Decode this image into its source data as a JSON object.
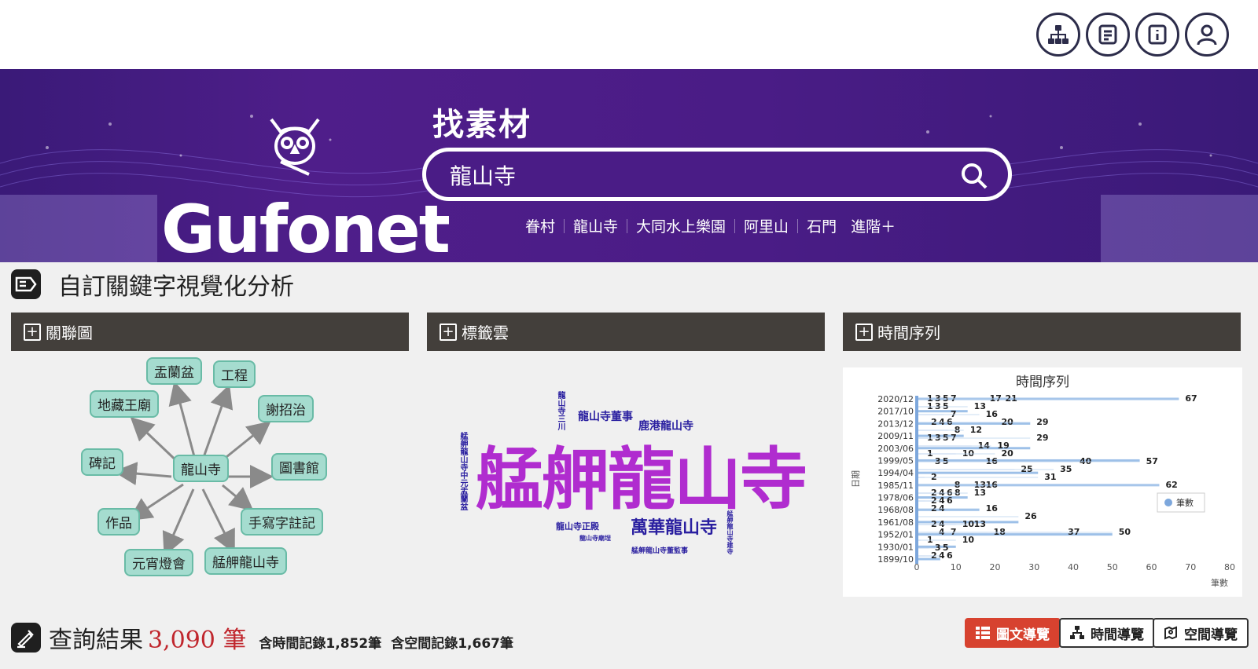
{
  "topbar": {
    "icons": [
      "sitemap-icon",
      "document-list-icon",
      "info-book-icon",
      "user-icon"
    ]
  },
  "banner": {
    "logo_text": "Gufonet",
    "search_title": "找素材",
    "search_value": "龍山寺",
    "quick_links": [
      "眷村",
      "龍山寺",
      "大同水上樂園",
      "阿里山",
      "石門",
      "進階＋"
    ]
  },
  "section": {
    "title": "自訂關鍵字視覺化分析"
  },
  "panels": {
    "network": "關聯圖",
    "tagcloud": "標籤雲",
    "timeseries": "時間序列"
  },
  "network": {
    "center": "龍山寺",
    "nodes": [
      "盂蘭盆",
      "工程",
      "地藏王廟",
      "謝招治",
      "碑記",
      "圖書館",
      "作品",
      "手寫字註記",
      "元宵燈會",
      "艋舺龍山寺"
    ]
  },
  "tagcloud": {
    "words": [
      "艋舺龍山寺",
      "萬華龍山寺",
      "龍山寺董事",
      "鹿港龍山寺",
      "龍山寺三川",
      "艋舺龍山寺中元盂蘭盆",
      "龍山寺正殿",
      "龍山寺廟埕",
      "艋舺龍山寺董監事",
      "艋舺龍山寺建寺"
    ]
  },
  "chart_data": {
    "type": "bar",
    "orientation": "horizontal",
    "title": "時間序列",
    "xlabel": "筆數",
    "ylabel": "日期",
    "xlim": [
      0,
      80
    ],
    "x_ticks": [
      0,
      10,
      20,
      30,
      40,
      50,
      60,
      70,
      80
    ],
    "legend": {
      "entries": [
        "筆數"
      ],
      "placement": "right"
    },
    "categories": [
      "2020/12",
      "2017/10",
      "2013/12",
      "2009/11",
      "2003/06",
      "1999/05",
      "1994/04",
      "1985/11",
      "1978/06",
      "1968/08",
      "1961/08",
      "1952/01",
      "1930/01",
      "1899/10"
    ],
    "series": [
      {
        "name": "筆數",
        "values": [
          67,
          13,
          29,
          12,
          29,
          57,
          31,
          62,
          13,
          16,
          26,
          50,
          10,
          6
        ]
      }
    ],
    "data_labels": [
      [
        1,
        3,
        5,
        7,
        17,
        21,
        67
      ],
      [
        1,
        3,
        5,
        13
      ],
      [
        7,
        16
      ],
      [
        2,
        4,
        6,
        20,
        29
      ],
      [
        8,
        12
      ],
      [
        1,
        3,
        5,
        7,
        29
      ],
      [
        14,
        19
      ],
      [
        1,
        10,
        20
      ],
      [
        3,
        5,
        16,
        40,
        57
      ],
      [
        25,
        35
      ],
      [
        2,
        31
      ],
      [
        8,
        13,
        16,
        62
      ],
      [
        2,
        4,
        6,
        8,
        13
      ],
      [
        2,
        4,
        6
      ],
      [
        2,
        4,
        16
      ],
      [
        26
      ],
      [
        2,
        4,
        10,
        13
      ],
      [
        4,
        7,
        18,
        37,
        50
      ],
      [
        1,
        10
      ],
      [
        3,
        5
      ],
      [
        2,
        4,
        6
      ]
    ]
  },
  "results": {
    "label": "查詢結果",
    "count": "3,090 筆",
    "time_records": "含時間記錄1,852筆",
    "space_records": "含空間記錄1,667筆",
    "buttons": [
      "圖文導覽",
      "時間導覽",
      "空間導覽"
    ]
  }
}
